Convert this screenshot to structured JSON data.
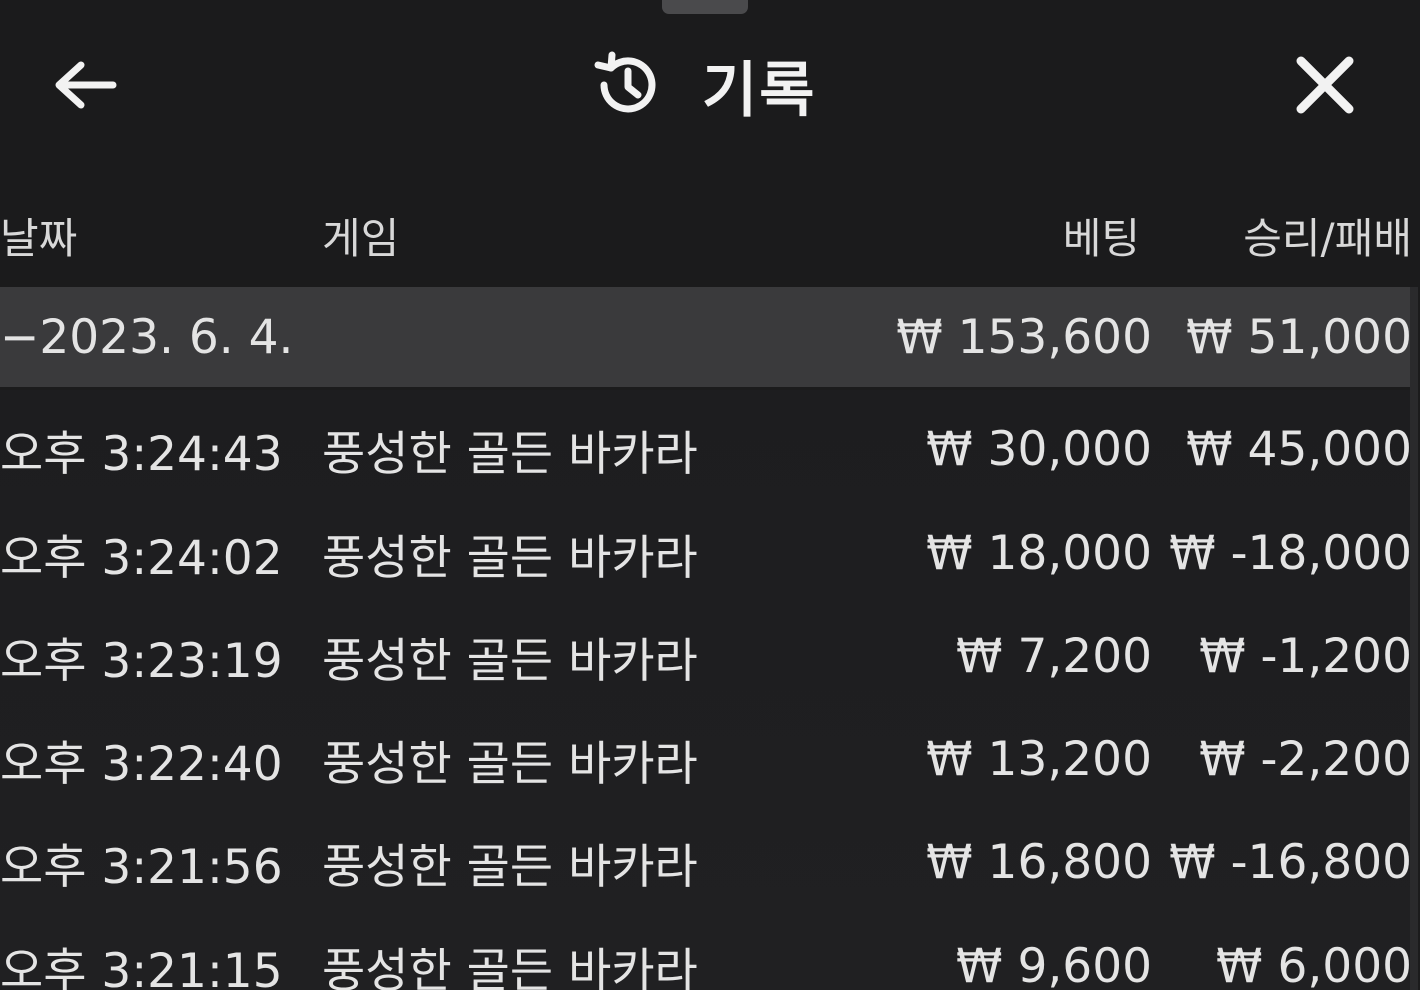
{
  "header": {
    "title": "기록",
    "back_icon": "arrow-left-icon",
    "history_icon": "history-icon",
    "close_icon": "close-icon"
  },
  "columns": {
    "date": "날짜",
    "game": "게임",
    "bet": "베팅",
    "win_loss": "승리/패배"
  },
  "date_group": {
    "date": "−2023. 6. 4.",
    "total_bet": "₩ 153,600",
    "total_win_loss": "₩ 51,000"
  },
  "rows": [
    {
      "time": "오후 3:24:43",
      "game": "풍성한 골든 바카라",
      "bet": "₩ 30,000",
      "result": "₩ 45,000"
    },
    {
      "time": "오후 3:24:02",
      "game": "풍성한 골든 바카라",
      "bet": "₩ 18,000",
      "result": "₩ -18,000"
    },
    {
      "time": "오후 3:23:19",
      "game": "풍성한 골든 바카라",
      "bet": "₩ 7,200",
      "result": "₩ -1,200"
    },
    {
      "time": "오후 3:22:40",
      "game": "풍성한 골든 바카라",
      "bet": "₩ 13,200",
      "result": "₩ -2,200"
    },
    {
      "time": "오후 3:21:56",
      "game": "풍성한 골든 바카라",
      "bet": "₩ 16,800",
      "result": "₩ -16,800"
    },
    {
      "time": "오후 3:21:15",
      "game": "풍성한 골든 바카라",
      "bet": "₩ 9,600",
      "result": "₩ 6,000"
    }
  ]
}
